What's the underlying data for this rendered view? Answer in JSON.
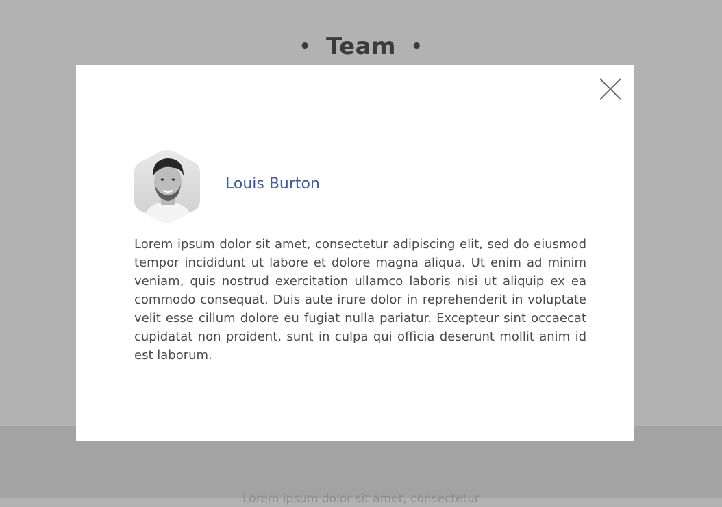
{
  "page": {
    "section_title": "Team",
    "heading_bullet": "•",
    "footer_text": "Lorem ipsum dolor sit amet, consectetur"
  },
  "modal": {
    "close_icon": "close-icon",
    "member": {
      "name": "Louis Burton",
      "avatar_icon": "avatar-photo",
      "bio": "Lorem ipsum dolor sit amet, consectetur adipiscing elit, sed do eiusmod tempor incididunt ut labore et dolore magna aliqua. Ut enim ad minim veniam, quis nostrud exercitation ullamco laboris nisi ut aliquip ex ea commodo consequat. Duis aute irure dolor in reprehenderit in voluptate velit esse cillum dolore eu fugiat nulla pariatur. Excepteur sint occaecat cupidatat non proident, sunt in culpa qui officia deserunt mollit anim id est laborum."
    }
  },
  "colors": {
    "overlay": "#b2b2b2",
    "overlay_footer": "#a3a3a3",
    "modal_background": "#ffffff",
    "name_accent": "#3b5aa6",
    "body_text": "#4a4a4a",
    "heading_text": "#3b3b3b"
  }
}
